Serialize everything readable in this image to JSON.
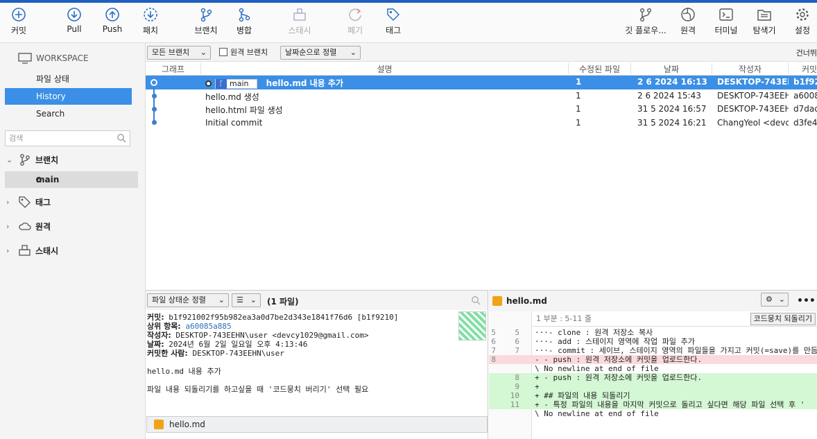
{
  "toolbar": {
    "commit": "커밋",
    "pull": "Pull",
    "push": "Push",
    "fetch": "패치",
    "branch": "브랜치",
    "merge": "병합",
    "stash": "스태시",
    "discard": "폐기",
    "tag": "태그",
    "gitflow": "깃 플로우...",
    "remote": "원격",
    "terminal": "터미널",
    "explorer": "탐색기",
    "settings": "설정"
  },
  "sidebar": {
    "workspace": "WORKSPACE",
    "file_status": "파일 상태",
    "history": "History",
    "search": "Search",
    "search_placeholder": "검색",
    "branches": "브랜치",
    "branch_main": "main",
    "tags": "태그",
    "remotes": "원격",
    "stashes": "스태시"
  },
  "filter": {
    "all_branches": "모든 브랜치",
    "remote_branches": "원격 브랜치",
    "sort": "날짜순으로 정렬",
    "skip": "건너뛰"
  },
  "columns": {
    "graph": "그래프",
    "description": "설명",
    "modified": "수정된 파일",
    "date": "날짜",
    "author": "작성자",
    "commit": "커밋"
  },
  "commits": [
    {
      "branch": "main",
      "description": "hello.md 내용 추가",
      "modified": "1",
      "date": "2 6 2024 16:13",
      "author": "DESKTOP-743EEH",
      "hash": "b1f92"
    },
    {
      "description": "hello.md 생성",
      "modified": "1",
      "date": "2 6 2024 15:43",
      "author": "DESKTOP-743EEH",
      "hash": "a6008"
    },
    {
      "description": "hello.html 파일 생성",
      "modified": "1",
      "date": "31 5 2024 16:57",
      "author": "DESKTOP-743EEH",
      "hash": "d7dad"
    },
    {
      "description": "Initial commit",
      "modified": "1",
      "date": "31 5 2024 16:21",
      "author": "ChangYeol <devcy",
      "hash": "d3fe4"
    }
  ],
  "details": {
    "sort": "파일 상태순 정렬",
    "file_count": "(1 파일)",
    "commit_label": "커밋:",
    "commit_value": "b1f921002f95b982ea3a0d7be2d343e1841f76d6 [b1f9210]",
    "parent_label": "상위 항목:",
    "parent_value": "a60085a885",
    "author_label": "작성자:",
    "author_value": "DESKTOP-743EEHN\\user <devcy1029@gmail.com>",
    "date_label": "날짜:",
    "date_value": "2024년 6월 2일 일요일 오후 4:13:46",
    "committer_label": "커밋한 사람:",
    "committer_value": "DESKTOP-743EEHN\\user",
    "message1": "hello.md 내용 추가",
    "message2": "파일 내용 되돌리기를 하고싶을 때 '코드뭉치 버리기' 선택 필요",
    "file": "hello.md"
  },
  "diff": {
    "file": "hello.md",
    "hunk": "1 부분 : 5-11 줄",
    "discard_hunk": "코드뭉치 되돌리기",
    "lines": [
      {
        "type": "ctx",
        "old": "5",
        "new": "5",
        "text": "···- clone : 원격 저장소 복사"
      },
      {
        "type": "ctx",
        "old": "6",
        "new": "6",
        "text": "···- add : 스테이지 영역에 작업 파일 추가"
      },
      {
        "type": "ctx",
        "old": "7",
        "new": "7",
        "text": "···- commit : 세이브, 스테이지 영역의 파일들을 가지고 커밋(=save)를 만듬"
      },
      {
        "type": "del",
        "old": "8",
        "new": "",
        "text": "- - push : 원격 저장소에 커밋을 업로드한다."
      },
      {
        "type": "ctx",
        "old": "",
        "new": "",
        "text": "\\ No newline at end of file"
      },
      {
        "type": "add",
        "old": "",
        "new": "8",
        "text": "+ - push : 원격 저장소에 커밋을 업로드한다."
      },
      {
        "type": "add",
        "old": "",
        "new": "9",
        "text": "+"
      },
      {
        "type": "add",
        "old": "",
        "new": "10",
        "text": "+ ## 파일의 내용 되돌리기"
      },
      {
        "type": "add",
        "old": "",
        "new": "11",
        "text": "+ - 특정 파일의 내용을 마지막 커밋으로 돌리고 싶다면 해당 파일 선택 후 '"
      },
      {
        "type": "ctx",
        "old": "",
        "new": "",
        "text": "\\ No newline at end of file"
      }
    ]
  }
}
